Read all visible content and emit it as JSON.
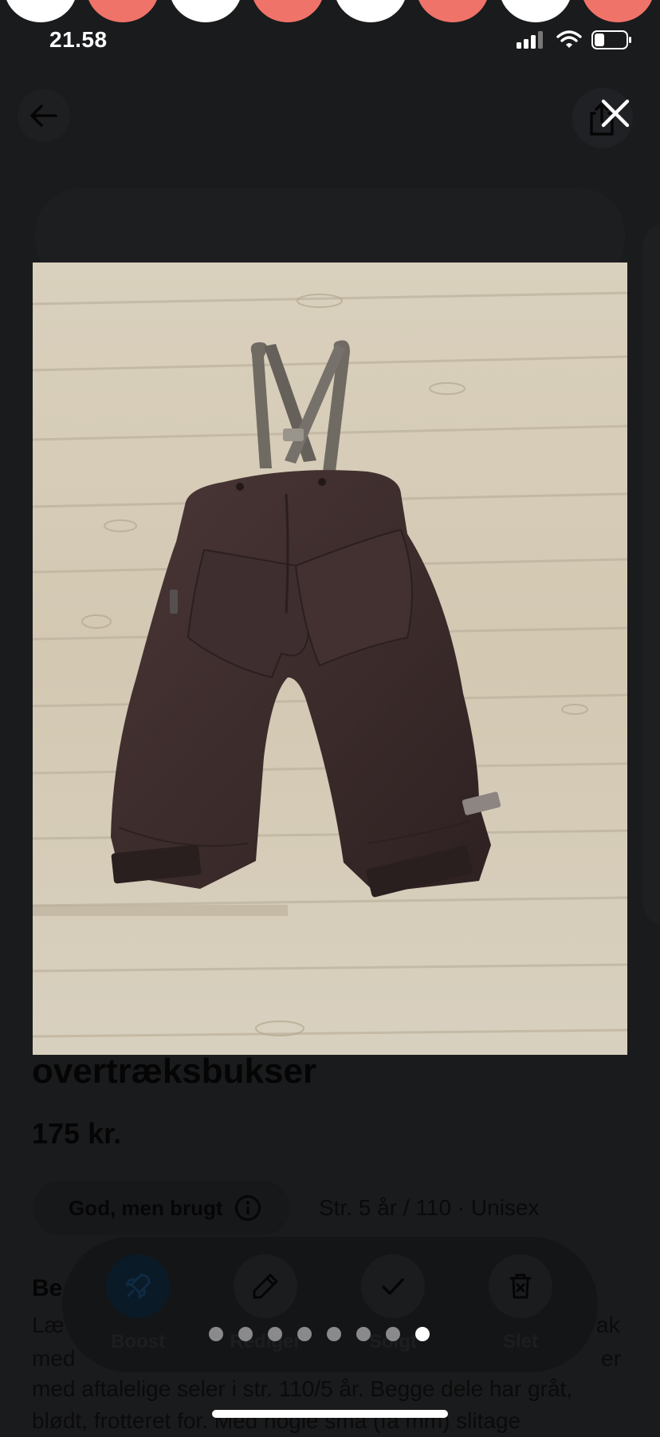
{
  "status_bar": {
    "time": "21.58"
  },
  "listing": {
    "title": "overtræksbukser",
    "price": "175 kr.",
    "condition": "God, men brugt",
    "size_info": "Str. 5 år / 110 · Unisex",
    "description_heading": "Be",
    "description_lines": [
      "Læ",
      "med",
      "med aftalelige seler i str. 110/5 år. Begge dele har gråt,",
      "blødt, frotteret for. Med nogle små (få mm) slitage"
    ],
    "description_right_fragments": [
      "ak",
      "er"
    ]
  },
  "actions": [
    {
      "label": "Boost",
      "icon": "rocket-icon"
    },
    {
      "label": "Rediger",
      "icon": "pencil-icon"
    },
    {
      "label": "Solgt",
      "icon": "check-icon"
    },
    {
      "label": "Slet",
      "icon": "trash-icon"
    }
  ],
  "gallery": {
    "image_count": 8,
    "active_index": 7
  },
  "colors": {
    "background": "#1a1b1c",
    "story_coral": "#f0736a",
    "story_white": "#ffffff",
    "floor": "#d6cdb9",
    "pants": "#3a2a2a",
    "strap": "#6f6a62"
  }
}
